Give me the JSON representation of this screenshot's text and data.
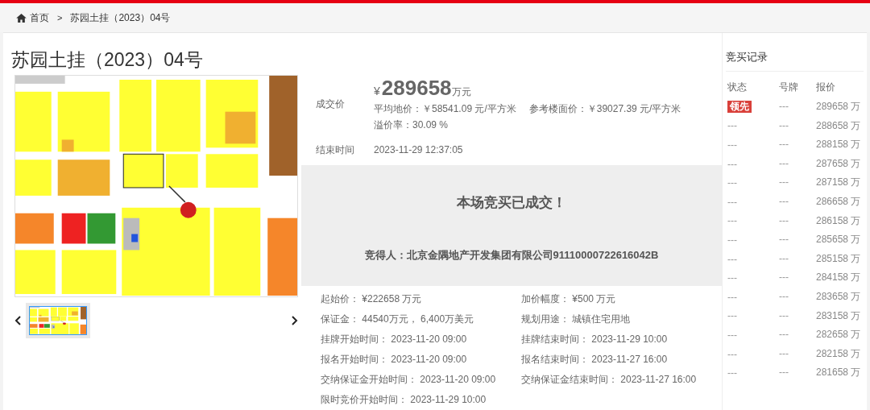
{
  "breadcrumb": {
    "items": [
      "首页",
      "苏园土挂（2023）04号"
    ],
    "separator": ">"
  },
  "title": "苏园土挂（2023）04号",
  "gallery": {
    "thumbnails": [
      {
        "selected": true
      }
    ]
  },
  "deal": {
    "price_label": "成交价",
    "currency": "¥",
    "price": "289658",
    "price_unit": "万元",
    "stats": [
      "平均地价：￥58541.09 元/平方米",
      "参考楼面价：￥39027.39 元/平方米",
      "溢价率：30.09 %"
    ],
    "end_label": "结束时间",
    "end_time": "2023-11-29 12:37:05"
  },
  "result": {
    "headline": "本场竞买已成交！",
    "winner": "竞得人：北京金隅地产开发集团有限公司91110000722616042B"
  },
  "details": [
    {
      "label": "起始价：",
      "value": "¥222658 万元"
    },
    {
      "label": "加价幅度：",
      "value": "¥500 万元"
    },
    {
      "label": "保证金：",
      "value": "44540万元， 6,400万美元"
    },
    {
      "label": "规划用途：",
      "value": "城镇住宅用地"
    },
    {
      "label": "挂牌开始时间：",
      "value": "2023-11-20 09:00"
    },
    {
      "label": "挂牌结束时间：",
      "value": "2023-11-29 10:00"
    },
    {
      "label": "报名开始时间：",
      "value": "2023-11-20 09:00"
    },
    {
      "label": "报名结束时间：",
      "value": "2023-11-27 16:00"
    },
    {
      "label": "交纳保证金开始时间：",
      "value": "2023-11-20 09:00"
    },
    {
      "label": "交纳保证金结束时间：",
      "value": "2023-11-27 16:00"
    },
    {
      "label": "限时竞价开始时间：",
      "value": "2023-11-29 10:00"
    }
  ],
  "bids": {
    "title": "竞买记录",
    "columns": [
      "状态",
      "号牌",
      "报价"
    ],
    "rows": [
      {
        "status": "领先",
        "leading": true,
        "plate": "---",
        "price": "289658 万"
      },
      {
        "status": "---",
        "leading": false,
        "plate": "---",
        "price": "288658 万"
      },
      {
        "status": "---",
        "leading": false,
        "plate": "---",
        "price": "288158 万"
      },
      {
        "status": "---",
        "leading": false,
        "plate": "---",
        "price": "287658 万"
      },
      {
        "status": "---",
        "leading": false,
        "plate": "---",
        "price": "287158 万"
      },
      {
        "status": "---",
        "leading": false,
        "plate": "---",
        "price": "286658 万"
      },
      {
        "status": "---",
        "leading": false,
        "plate": "---",
        "price": "286158 万"
      },
      {
        "status": "---",
        "leading": false,
        "plate": "---",
        "price": "285658 万"
      },
      {
        "status": "---",
        "leading": false,
        "plate": "---",
        "price": "285158 万"
      },
      {
        "status": "---",
        "leading": false,
        "plate": "---",
        "price": "284158 万"
      },
      {
        "status": "---",
        "leading": false,
        "plate": "---",
        "price": "283658 万"
      },
      {
        "status": "---",
        "leading": false,
        "plate": "---",
        "price": "283158 万"
      },
      {
        "status": "---",
        "leading": false,
        "plate": "---",
        "price": "282658 万"
      },
      {
        "status": "---",
        "leading": false,
        "plate": "---",
        "price": "282158 万"
      },
      {
        "status": "---",
        "leading": false,
        "plate": "---",
        "price": "281658 万"
      }
    ]
  }
}
